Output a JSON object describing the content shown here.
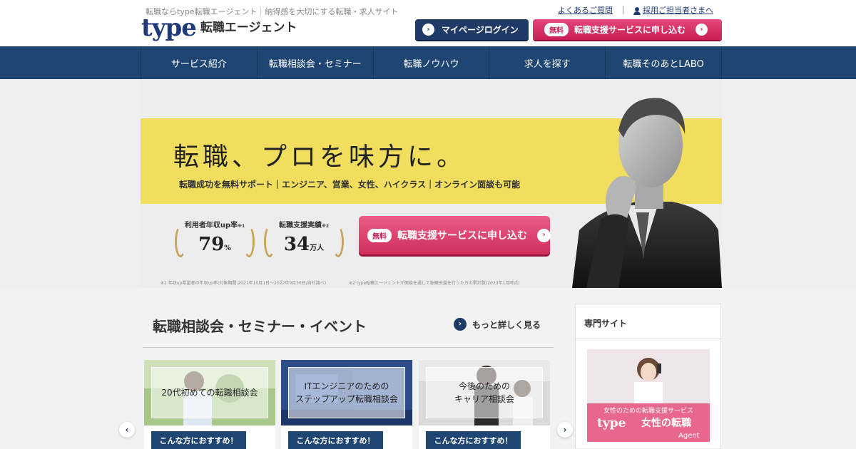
{
  "header": {
    "tagline": "転職ならtype転職エージェント｜納得感を大切にする転職・求人サイト",
    "logo_type": "type",
    "logo_sub": "転職エージェント",
    "faq_link": "よくあるご質問",
    "recruiter_link": "採用ご担当者さまへ",
    "mypage_label": "マイページログイン",
    "free_badge": "無料",
    "apply_label": "転職支援サービスに申し込む"
  },
  "nav": {
    "items": [
      {
        "label": "サービス紹介"
      },
      {
        "label": "転職相談会・セミナー"
      },
      {
        "label": "転職ノウハウ"
      },
      {
        "label": "求人を探す"
      },
      {
        "label": "転職そのあとLABO"
      }
    ]
  },
  "hero": {
    "title": "転職、プロを味方に。",
    "subtitle": "転職成功を無料サポート｜エンジニア、営業、女性、ハイクラス｜オンライン面談も可能",
    "stats": [
      {
        "label": "利用者年収up率",
        "note_mark": "※1",
        "value": "79",
        "unit": "%"
      },
      {
        "label": "転職支援実績",
        "note_mark": "※2",
        "value": "34",
        "unit": "万人"
      }
    ],
    "free_badge": "無料",
    "apply_label": "転職支援サービスに申し込む",
    "note1": "※1 年収up希望者の年収up率(対象期間:2021年10月1日〜2022年9月30日/自社調べ)",
    "note2": "※2 type転職エージェントが面談を通して転職支援を行った方の累計数(2023年1月時点)"
  },
  "events": {
    "title": "転職相談会・セミナー・イベント",
    "more_label": "もっと詳しく見る",
    "cards": [
      {
        "title": "20代初めての転職相談会",
        "tag": "こんな方におすすめ！"
      },
      {
        "title": "ITエンジニアのための\nステップアップ転職相談会",
        "tag": "こんな方におすすめ！"
      },
      {
        "title": "今後のための\nキャリア相談会",
        "tag": "こんな方におすすめ！"
      }
    ]
  },
  "side": {
    "title": "専門サイト",
    "banner_sub": "女性のための転職支援サービス",
    "banner_logo": "type",
    "banner_title": "女性の転職",
    "banner_agent": "Agent"
  },
  "colors": {
    "navy": "#1f4672",
    "pink": "#d02e5c",
    "yellow": "#f1de5e"
  }
}
